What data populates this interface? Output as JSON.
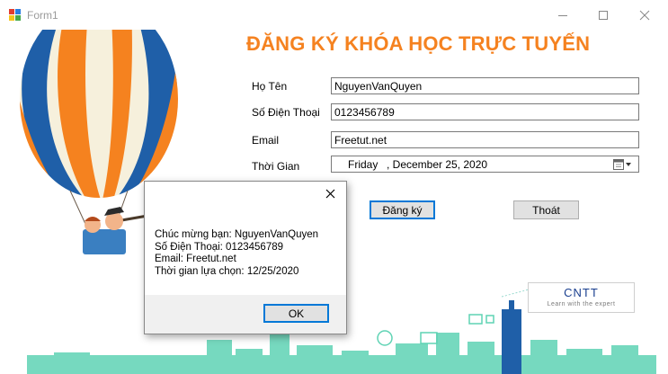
{
  "window": {
    "title": "Form1"
  },
  "form": {
    "heading": "ĐĂNG KÝ KHÓA HỌC TRỰC TUYẾN",
    "name_label": "Họ Tên",
    "name_value": "NguyenVanQuyen",
    "phone_label": "Số Điện Thoại",
    "phone_value": "0123456789",
    "email_label": "Email",
    "email_value": "Freetut.net",
    "time_label": "Thời Gian",
    "date_day": "Friday",
    "date_rest": ", December 25, 2020",
    "register_label": "Đăng ký",
    "exit_label": "Thoát"
  },
  "dialog": {
    "lines": [
      "Chúc mừng bạn: NguyenVanQuyen",
      "Số Điện Thoại: 0123456789",
      "Email: Freetut.net",
      "Thời gian lựa chọn: 12/25/2020"
    ],
    "ok_label": "OK"
  },
  "logo": {
    "text": "CNTT",
    "tagline": "Learn with the expert"
  },
  "colors": {
    "heading": "#f58220",
    "balloon_orange": "#f5821f",
    "balloon_blue": "#1f5fa8",
    "city_green": "#5fd3b4",
    "focus_blue": "#0078d7"
  }
}
